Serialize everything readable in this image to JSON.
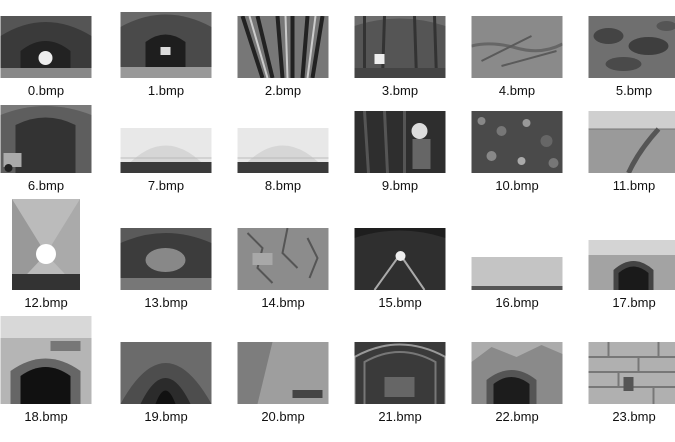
{
  "files": [
    {
      "name": "0.bmp",
      "subject": "tunnel-interior-lit"
    },
    {
      "name": "1.bmp",
      "subject": "tunnel-construction-arch"
    },
    {
      "name": "2.bmp",
      "subject": "rock-bolts-closeup"
    },
    {
      "name": "3.bmp",
      "subject": "tunnel-steel-frame"
    },
    {
      "name": "4.bmp",
      "subject": "ground-surface"
    },
    {
      "name": "5.bmp",
      "subject": "eroded-surface"
    },
    {
      "name": "6.bmp",
      "subject": "tunnel-excavator"
    },
    {
      "name": "7.bmp",
      "subject": "tunnel-render-white"
    },
    {
      "name": "8.bmp",
      "subject": "tunnel-render-white"
    },
    {
      "name": "9.bmp",
      "subject": "worker-drilling"
    },
    {
      "name": "10.bmp",
      "subject": "gravel-ground"
    },
    {
      "name": "11.bmp",
      "subject": "field-road"
    },
    {
      "name": "12.bmp",
      "subject": "tunnel-lights-perspective"
    },
    {
      "name": "13.bmp",
      "subject": "tunnel-excavation-face"
    },
    {
      "name": "14.bmp",
      "subject": "cracked-wall"
    },
    {
      "name": "15.bmp",
      "subject": "tunnel-rails"
    },
    {
      "name": "16.bmp",
      "subject": "concrete-strip"
    },
    {
      "name": "17.bmp",
      "subject": "tunnel-portal-outdoor"
    },
    {
      "name": "18.bmp",
      "subject": "highway-tunnel-portal"
    },
    {
      "name": "19.bmp",
      "subject": "tunnel-ribbed-arch"
    },
    {
      "name": "20.bmp",
      "subject": "tunnel-wall-watermark"
    },
    {
      "name": "21.bmp",
      "subject": "tunnel-steel-arches"
    },
    {
      "name": "22.bmp",
      "subject": "tunnel-portal-hill"
    },
    {
      "name": "23.bmp",
      "subject": "stone-retaining-wall"
    }
  ]
}
